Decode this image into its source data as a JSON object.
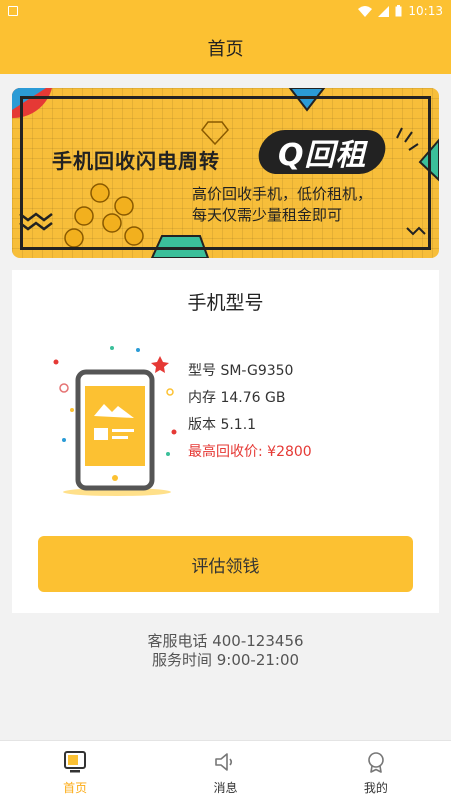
{
  "status_bar": {
    "time": "10:13"
  },
  "header": {
    "title": "首页"
  },
  "banner": {
    "headline": "手机回收闪电周转",
    "badge": "Q回租",
    "subtitle_line1": "高价回收手机，低价租机，",
    "subtitle_line2": "每天仅需少量租金即可"
  },
  "product": {
    "title": "手机型号",
    "model": "型号 SM-G9350",
    "storage": "内存 14.76 GB",
    "version": "版本 5.1.1",
    "max_price": "最高回收价: ¥2800",
    "evaluate_button": "评估领钱"
  },
  "contact": {
    "phone": "客服电话 400-123456",
    "hours": "服务时间 9:00-21:00"
  },
  "nav": {
    "items": [
      {
        "label": "首页",
        "icon": "home-tv-icon",
        "active": true
      },
      {
        "label": "消息",
        "icon": "speaker-icon",
        "active": false
      },
      {
        "label": "我的",
        "icon": "user-badge-icon",
        "active": false
      }
    ]
  },
  "colors": {
    "accent": "#fcc132",
    "active_nav": "#fcab14",
    "price": "#e53935"
  }
}
